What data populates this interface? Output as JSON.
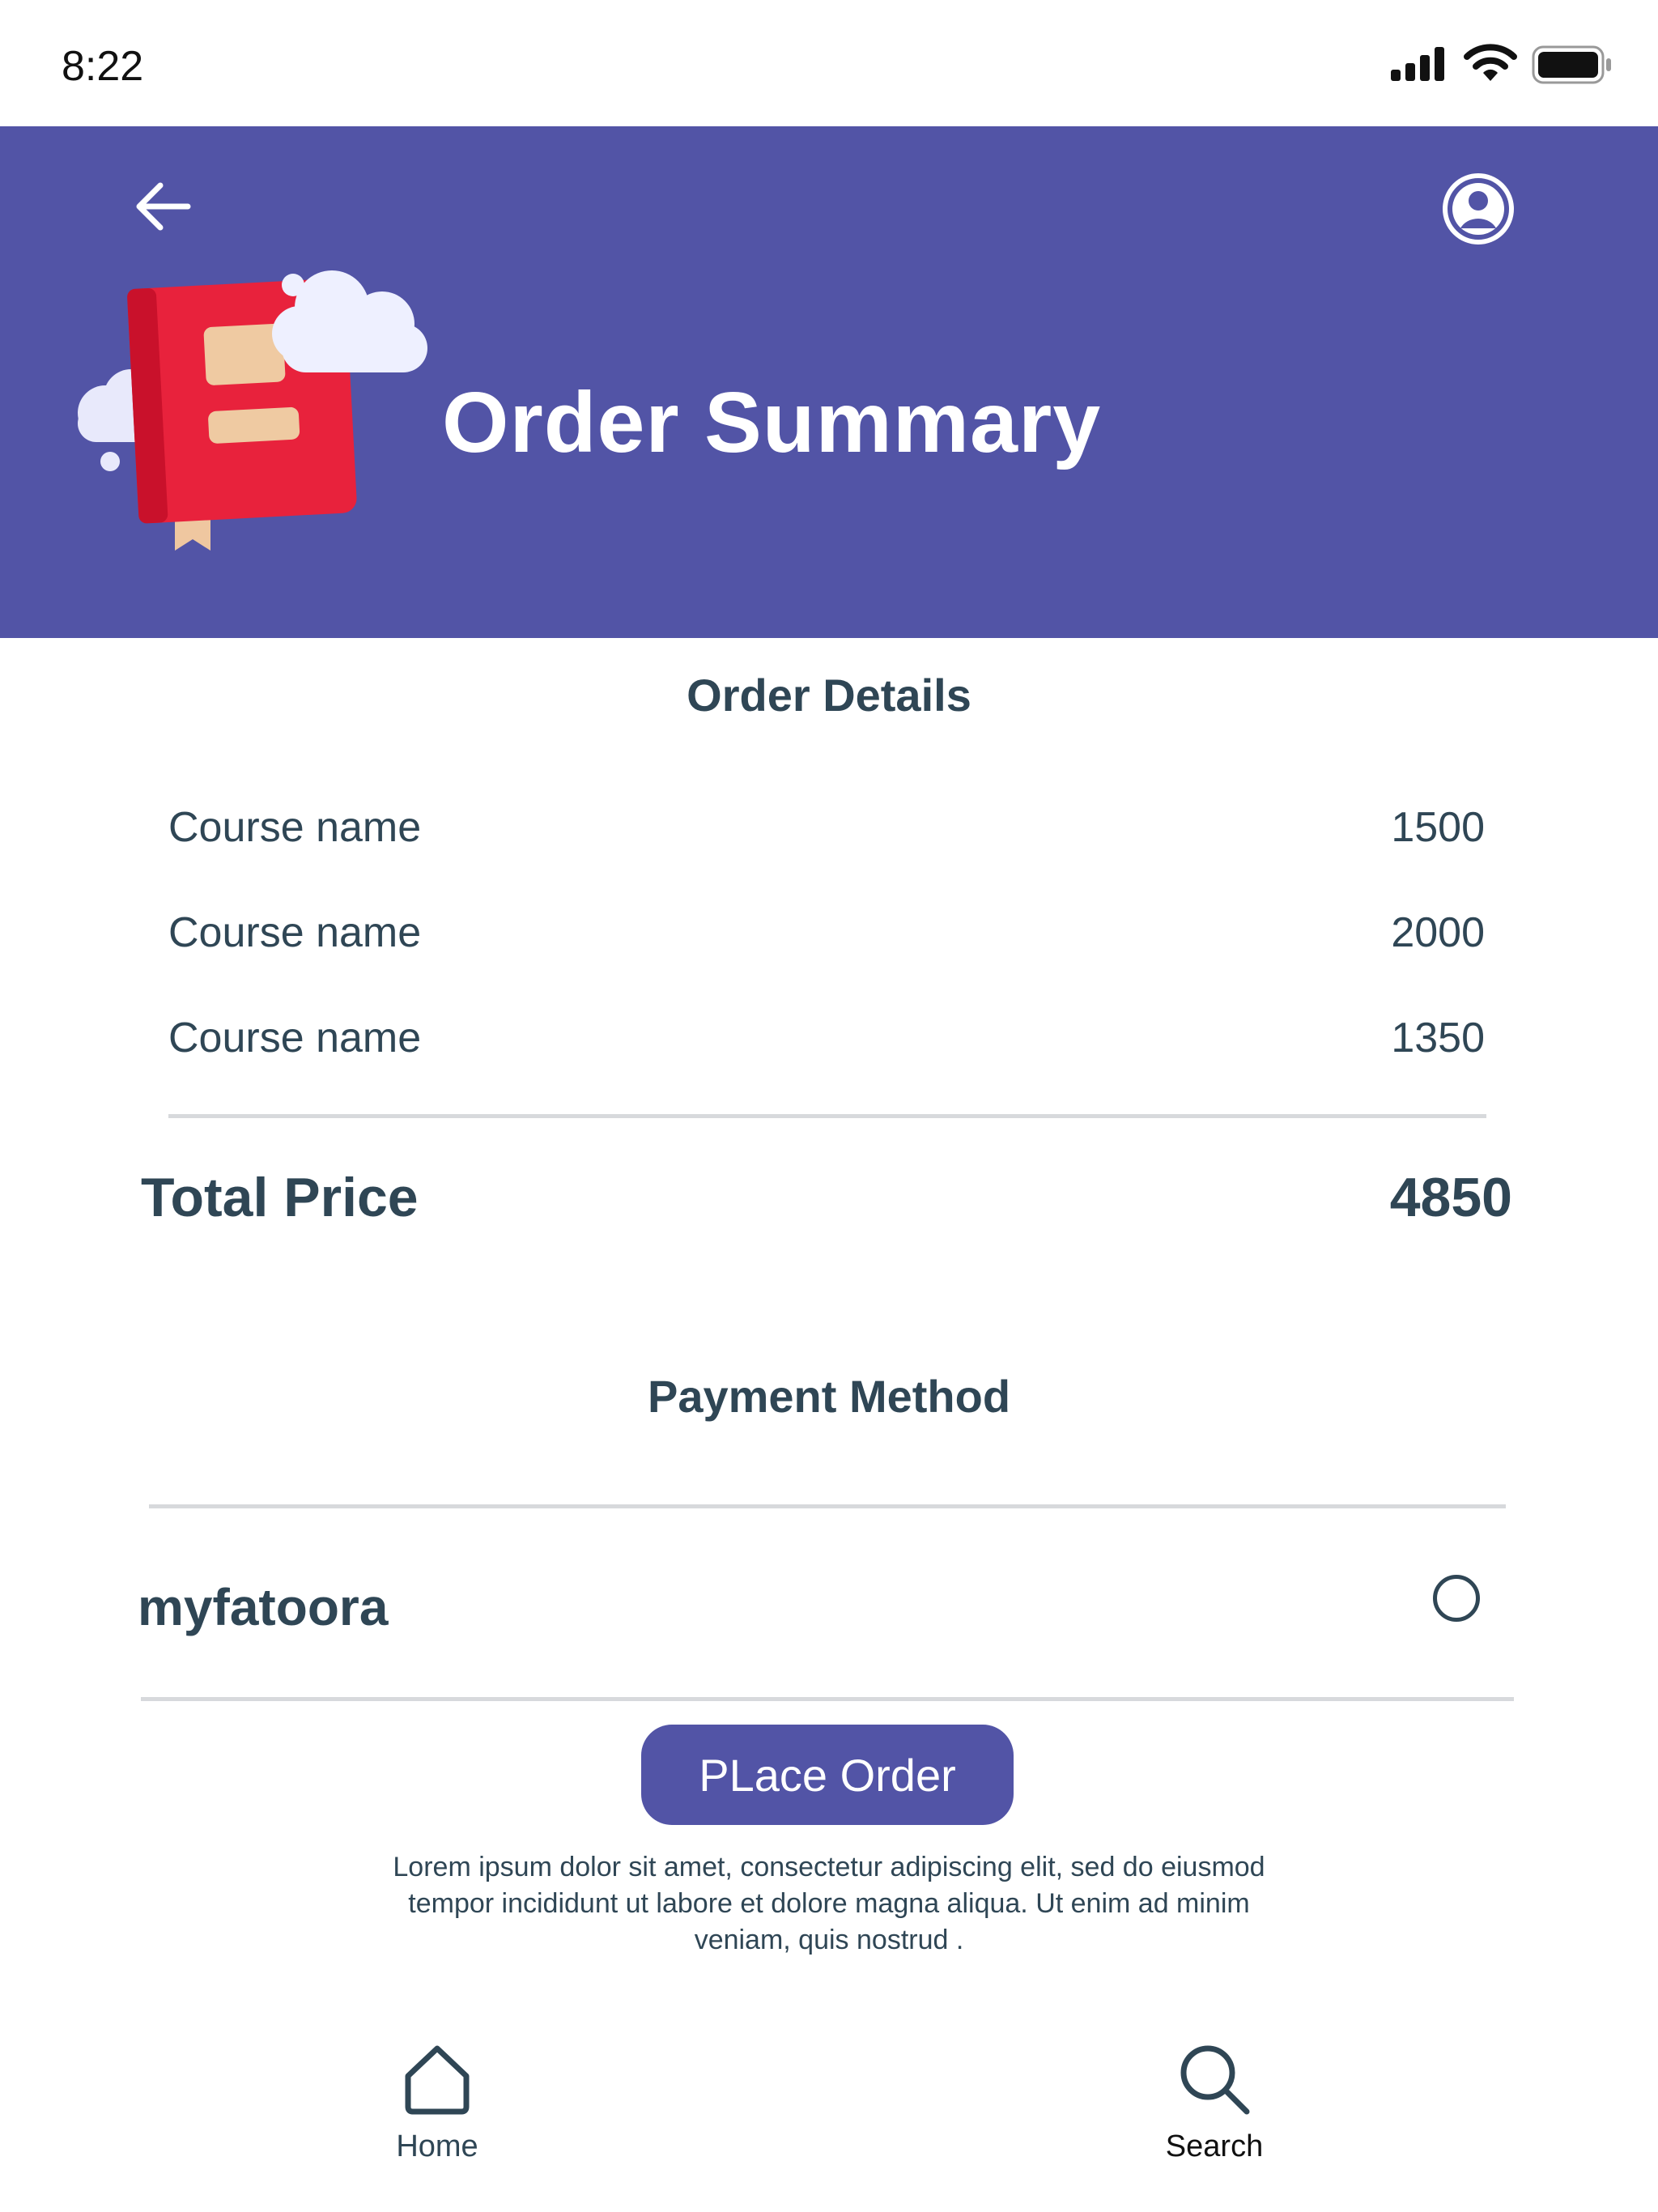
{
  "status_bar": {
    "time": "8:22"
  },
  "header": {
    "title": "Order Summary",
    "color": "#5254a6"
  },
  "order_details": {
    "title": "Order Details",
    "items": [
      {
        "name": "Course name",
        "price": "1500"
      },
      {
        "name": "Course name",
        "price": "2000"
      },
      {
        "name": "Course name",
        "price": "1350"
      }
    ],
    "total_label": "Total Price",
    "total_value": "4850"
  },
  "payment": {
    "title": "Payment Method",
    "method_name": "myfatoora",
    "selected": false
  },
  "actions": {
    "place_order_label": "PLace Order"
  },
  "disclaimer": "Lorem ipsum dolor sit amet, consectetur adipiscing elit, sed do eiusmod tempor incididunt ut labore et dolore magna aliqua. Ut enim ad minim veniam, quis nostrud .",
  "bottom_nav": [
    {
      "label": "Home",
      "icon": "home-icon"
    },
    {
      "label": "Search",
      "icon": "search-icon"
    }
  ]
}
